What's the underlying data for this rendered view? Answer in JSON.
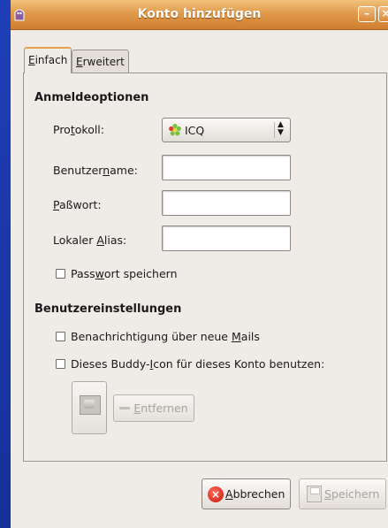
{
  "window": {
    "title": "Konto hinzufügen"
  },
  "tabs": [
    {
      "mnemonic": "E",
      "rest": "infach",
      "active": true
    },
    {
      "mnemonic": "E",
      "rest": "rweitert",
      "active": false
    }
  ],
  "login_section": {
    "heading": "Anmeldeoptionen",
    "protocol": {
      "label_pre": "Pro",
      "label_u": "t",
      "label_post": "okoll:",
      "value": "ICQ"
    },
    "username": {
      "label_pre": "Benutzer",
      "label_u": "n",
      "label_post": "ame:",
      "value": ""
    },
    "password": {
      "label_pre": "",
      "label_u": "P",
      "label_post": "aßwort:",
      "value": ""
    },
    "alias": {
      "label_pre": "Lokaler ",
      "label_u": "A",
      "label_post": "lias:",
      "value": ""
    },
    "remember_password": {
      "label_pre": "Pass",
      "label_u": "w",
      "label_post": "ort speichern",
      "checked": false
    }
  },
  "user_section": {
    "heading": "Benutzereinstellungen",
    "new_mail": {
      "label_pre": "Benachrichtigung über neue ",
      "label_u": "M",
      "label_post": "ails",
      "checked": false
    },
    "buddy_icon": {
      "label_pre": "Dieses Buddy-",
      "label_u": "I",
      "label_post": "con für dieses Konto benutzen:",
      "checked": false
    },
    "remove": {
      "label_u": "E",
      "label_post": "ntfernen"
    }
  },
  "buttons": {
    "cancel": {
      "label_u": "A",
      "label_post": "bbrechen"
    },
    "save": {
      "label_u": "S",
      "label_post": "peichern"
    }
  },
  "colors": {
    "titlebar": "#e09a4c",
    "window_bg": "#efebe7",
    "desktop": "#1a3bb0"
  }
}
